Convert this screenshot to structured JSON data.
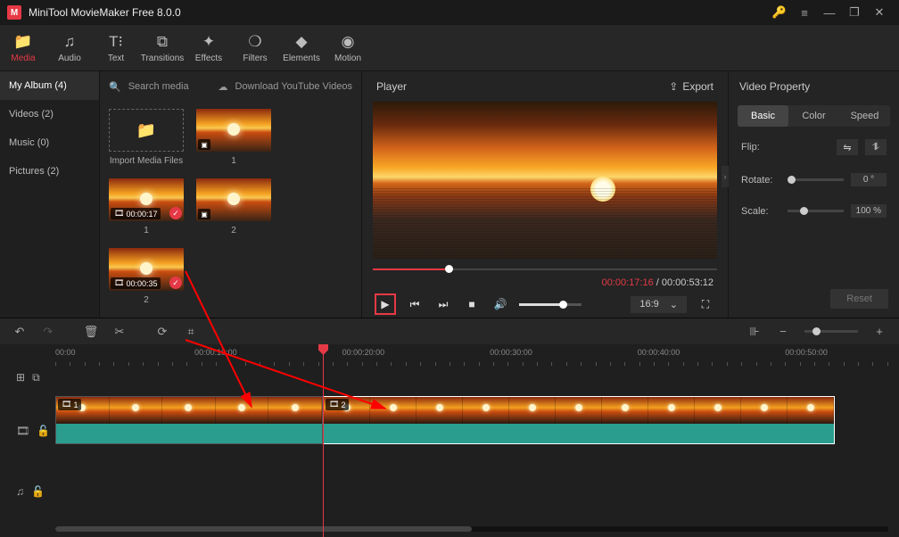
{
  "titlebar": {
    "app_name": "MiniTool MovieMaker Free 8.0.0"
  },
  "toolbar": {
    "items": [
      {
        "label": "Media"
      },
      {
        "label": "Audio"
      },
      {
        "label": "Text"
      },
      {
        "label": "Transitions"
      },
      {
        "label": "Effects"
      },
      {
        "label": "Filters"
      },
      {
        "label": "Elements"
      },
      {
        "label": "Motion"
      }
    ]
  },
  "sidebar": {
    "items": [
      {
        "label": "My Album (4)"
      },
      {
        "label": "Videos (2)"
      },
      {
        "label": "Music (0)"
      },
      {
        "label": "Pictures (2)"
      }
    ]
  },
  "media": {
    "search_placeholder": "Search media",
    "download_label": "Download YouTube Videos",
    "import_label": "Import Media Files",
    "items": [
      {
        "caption": "1",
        "kind": "picture"
      },
      {
        "caption": "1",
        "kind": "video",
        "duration": "00:00:17",
        "checked": true
      },
      {
        "caption": "2",
        "kind": "picture"
      },
      {
        "caption": "2",
        "kind": "video",
        "duration": "00:00:35",
        "checked": true
      }
    ]
  },
  "player": {
    "title": "Player",
    "export_label": "Export",
    "current_time": "00:00:17:16",
    "total_time": "00:00:53:12",
    "aspect": "16:9"
  },
  "props": {
    "title": "Video Property",
    "tabs": [
      {
        "label": "Basic"
      },
      {
        "label": "Color"
      },
      {
        "label": "Speed"
      }
    ],
    "flip_label": "Flip:",
    "rotate_label": "Rotate:",
    "rotate_value": "0 °",
    "scale_label": "Scale:",
    "scale_value": "100 %",
    "reset_label": "Reset"
  },
  "ruler": {
    "marks": [
      "00:00",
      "00:00:10:00",
      "00:00:20:00",
      "00:00:30:00",
      "00:00:40:00",
      "00:00:50:00"
    ]
  },
  "clips": [
    {
      "tag": "1"
    },
    {
      "tag": "2"
    }
  ]
}
